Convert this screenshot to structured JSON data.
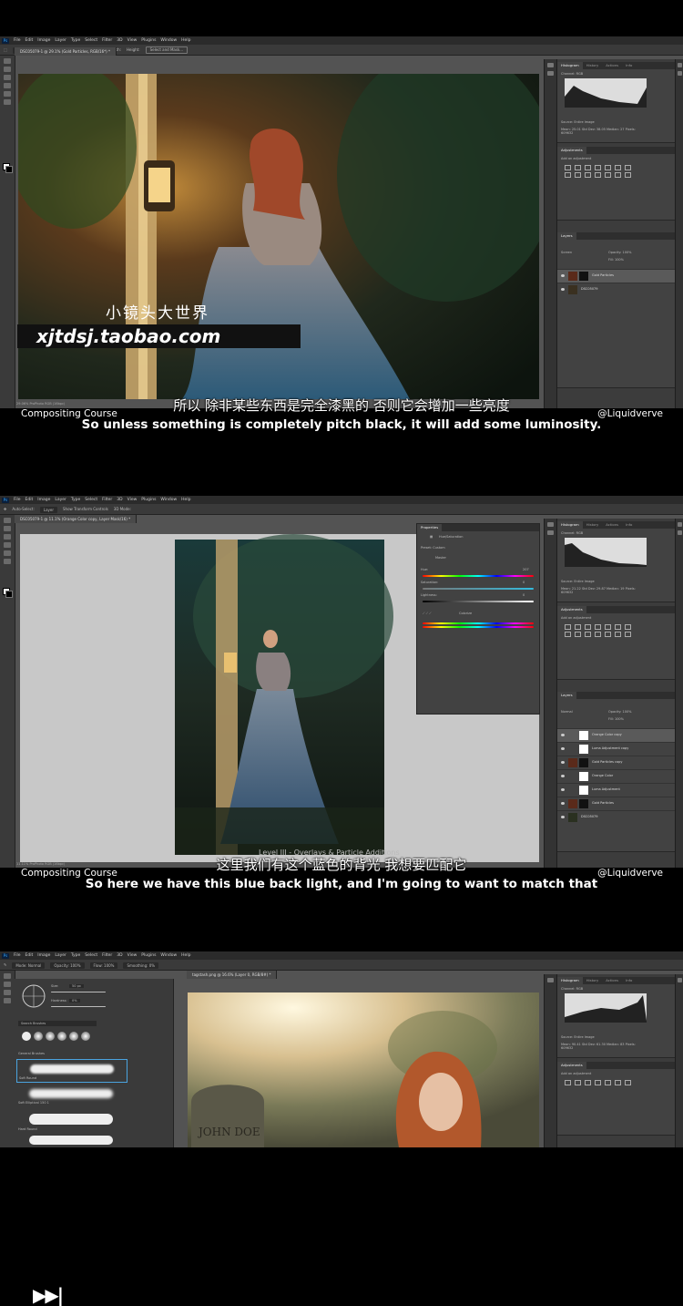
{
  "frames": [
    {
      "menu": [
        "Ps",
        "File",
        "Edit",
        "Image",
        "Layer",
        "Type",
        "Select",
        "Filter",
        "3D",
        "View",
        "Plugins",
        "Window",
        "Help"
      ],
      "options": {
        "feather": "Feather: 0 px",
        "antialias": "Anti-alias",
        "style": "Style: Normal",
        "width": "Width:",
        "height": "Height:",
        "select_mask": "Select and Mask..."
      },
      "doc_tab": "DSC05079-1 @ 29.1% (Gold Particles, RGB/16*) *",
      "status": "29.06%   ProPhoto RGB (16bpc)",
      "panels": {
        "histogram_tabs": [
          "Histogram",
          "History",
          "Actions",
          "Info"
        ],
        "channel": "Channel: RGB",
        "source": "Source: Entire Image",
        "stats": "Mean: 25.01  Std Dev: 38.05  Median: 27  Pixels: 609632",
        "adjustments_title": "Adjustments",
        "add_adjustment": "Add an adjustment",
        "layers_title": "Layers",
        "blend_mode": "Screen",
        "opacity": "Opacity: 100%",
        "fill": "Fill: 100%",
        "layers": [
          "Gold Particles",
          "DSC05079"
        ]
      },
      "watermark_cn": "小镜头大世界",
      "watermark_url": "xjtdsj.taobao.com",
      "subtitle_cn": "所以 除非某些东西是完全漆黑的 否则它会增加一些亮度",
      "subtitle_en": "So unless something is completely pitch black, it will add some luminosity.",
      "course": "Compositing Course",
      "handle": "@Liquidverve",
      "video_title": ""
    },
    {
      "menu": [
        "Ps",
        "File",
        "Edit",
        "Image",
        "Layer",
        "Type",
        "Select",
        "Filter",
        "3D",
        "View",
        "Plugins",
        "Window",
        "Help"
      ],
      "options": {
        "auto_select": "Auto-Select:",
        "layer": "Layer",
        "transform": "Show Transform Controls",
        "mode3d": "3D Mode:"
      },
      "doc_tab": "DSC05079-1 @ 11.1% (Orange Color copy, Layer Mask/16) *",
      "status": "11.11%   ProPhoto RGB (16bpc)",
      "properties": {
        "title": "Properties",
        "adjustment": "Hue/Saturation",
        "preset": "Preset: Custom",
        "channel": "Master",
        "hue_label": "Hue:",
        "hue_value": "207",
        "saturation_label": "Saturation:",
        "saturation_value": "0",
        "lightness_label": "Lightness:",
        "lightness_value": "0",
        "colorize": "Colorize"
      },
      "panels": {
        "histogram_tabs": [
          "Histogram",
          "History",
          "Actions",
          "Info"
        ],
        "channel": "Channel: RGB",
        "source": "Source: Entire Image",
        "stats": "Mean: 21.22  Std Dev: 29.87  Median: 19  Pixels: 609632",
        "adjustments_title": "Adjustments",
        "add_adjustment": "Add an adjustment",
        "layers_title": "Layers",
        "blend_mode": "Normal",
        "opacity": "Opacity: 100%",
        "fill": "Fill: 100%",
        "layers": [
          "Orange Color copy",
          "Luma Adjustment copy",
          "Gold Particles copy",
          "Orange Color",
          "Luma Adjustment",
          "Gold Particles",
          "DSC05079"
        ]
      },
      "skip_glyph": "▶▶|",
      "video_title": "Level III - Overlays & Particle Additions",
      "subtitle_cn": "这里我们有这个蓝色的背光 我想要匹配它",
      "subtitle_en": "So here we have this blue back light, and I'm going to want to match that",
      "course": "Compositing Course",
      "handle": "@Liquidverve"
    },
    {
      "menu": [
        "Ps",
        "File",
        "Edit",
        "Image",
        "Layer",
        "Type",
        "Select",
        "Filter",
        "3D",
        "View",
        "Plugins",
        "Window",
        "Help"
      ],
      "options": {
        "mode": "Mode: Normal",
        "opacity": "Opacity: 100%",
        "flow": "Flow: 100%",
        "smoothing": "Smoothing: 0%"
      },
      "doc_tab": "tagstash.png @ 16.6% (Layer 0, RGB/8#) *",
      "brushes": {
        "size": "Size:",
        "size_value": "50 px",
        "hardness": "Hardness:",
        "hardness_value": "0%",
        "search": "Search Brushes",
        "group": "General Brushes",
        "items": [
          "Soft Round",
          "Soft Elliptical 150 1",
          "Hard Round"
        ]
      },
      "tombstone": "JOHN DOE",
      "panels": {
        "histogram_tabs": [
          "Histogram",
          "History",
          "Actions",
          "Info"
        ],
        "channel": "Channel: RGB",
        "source": "Source: Entire Image",
        "stats": "Mean: 90.41  Std Dev: 61.30  Median: 83  Pixels: 609632",
        "adjustments_title": "Adjustments",
        "add_adjustment": "Add an adjustment"
      }
    }
  ]
}
